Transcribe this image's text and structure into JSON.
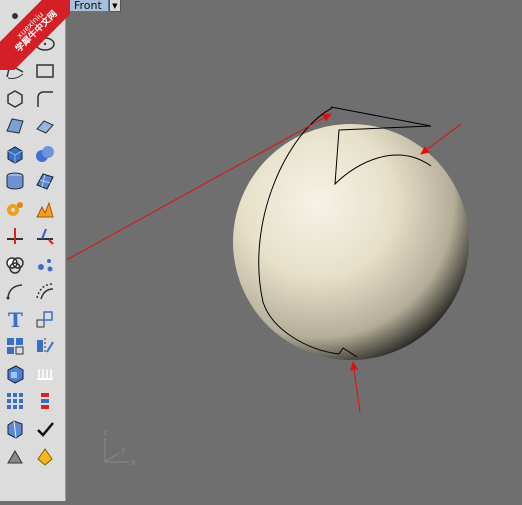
{
  "viewport": {
    "title": "Front",
    "dropdown_glyph": "▼"
  },
  "watermark": {
    "line1": "xuexiniu",
    "line2": "学犀牛中文网"
  },
  "axis": {
    "x_label": "x",
    "y_label": "y",
    "z_label": "z"
  },
  "toolbar": {
    "buttons": [
      "point-icon",
      "curve-icon",
      "circle-icon",
      "ellipse-icon",
      "arc-icon",
      "rectangle-icon",
      "polygon-icon",
      "curve-fillet-icon",
      "surface-corner-icon",
      "extrude-surface-icon",
      "box-icon",
      "sphere-union-icon",
      "cylinder-icon",
      "surface-patch-icon",
      "transform-gear-icon",
      "explode-icon",
      "split-icon",
      "trim-icon",
      "boolean-icon",
      "points-icon",
      "fillet-icon",
      "offset-icon",
      "text-icon",
      "scale-icon",
      "array-icon",
      "mirror-icon",
      "solid-box-icon",
      "dimension-icon",
      "grid-icon",
      "snap-icon",
      "render-icon",
      "check-icon",
      "material-icon",
      "light-icon"
    ]
  }
}
